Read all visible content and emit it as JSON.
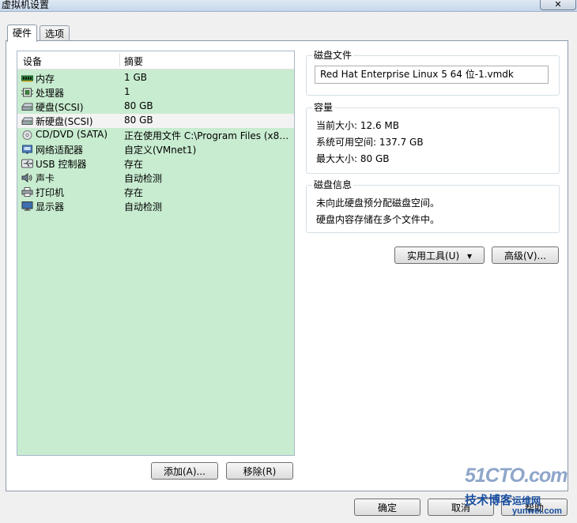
{
  "window": {
    "title": "虚拟机设置",
    "close_label": "✕"
  },
  "tabs": [
    {
      "label": "硬件",
      "active": true
    },
    {
      "label": "选项",
      "active": false
    }
  ],
  "device_list": {
    "headers": {
      "device": "设备",
      "summary": "摘要"
    },
    "rows": [
      {
        "name": "内存",
        "summary": "1 GB",
        "icon": "memory-icon"
      },
      {
        "name": "处理器",
        "summary": "1",
        "icon": "processor-icon"
      },
      {
        "name": "硬盘(SCSI)",
        "summary": "80 GB",
        "icon": "hard-disk-icon"
      },
      {
        "name": "新硬盘(SCSI)",
        "summary": "80 GB",
        "icon": "hard-disk-icon",
        "selected": true
      },
      {
        "name": "CD/DVD (SATA)",
        "summary": "正在使用文件 C:\\Program Files (x86...",
        "icon": "cd-dvd-icon"
      },
      {
        "name": "网络适配器",
        "summary": "自定义(VMnet1)",
        "icon": "network-adapter-icon"
      },
      {
        "name": "USB 控制器",
        "summary": "存在",
        "icon": "usb-icon"
      },
      {
        "name": "声卡",
        "summary": "自动检测",
        "icon": "sound-card-icon"
      },
      {
        "name": "打印机",
        "summary": "存在",
        "icon": "printer-icon"
      },
      {
        "name": "显示器",
        "summary": "自动检测",
        "icon": "display-icon"
      }
    ],
    "add_label": "添加(A)...",
    "remove_label": "移除(R)"
  },
  "disk_file": {
    "title": "磁盘文件",
    "value": "Red Hat Enterprise Linux 5 64 位-1.vmdk"
  },
  "capacity": {
    "title": "容量",
    "current_size": "当前大小: 12.6 MB",
    "system_free": "系统可用空间: 137.7 GB",
    "max_size": "最大大小: 80 GB"
  },
  "disk_info": {
    "title": "磁盘信息",
    "line1": "未向此硬盘预分配磁盘空间。",
    "line2": "硬盘内容存储在多个文件中。"
  },
  "actions": {
    "utilities_label": "实用工具(U)",
    "utilities_arrow": "▾",
    "advanced_label": "高级(V)..."
  },
  "footer": {
    "ok_label": "确定",
    "cancel_label": "取消",
    "help_label": "帮助"
  },
  "watermark": {
    "brand": "51CTO.com",
    "slogan": "技术博客",
    "slogan2": "运维网",
    "url": "yunwei.com"
  },
  "colors": {
    "list_background": "#c8ecd0",
    "selected_row": "#f3f3f3",
    "watermark_blue": "#1a4fa0"
  }
}
